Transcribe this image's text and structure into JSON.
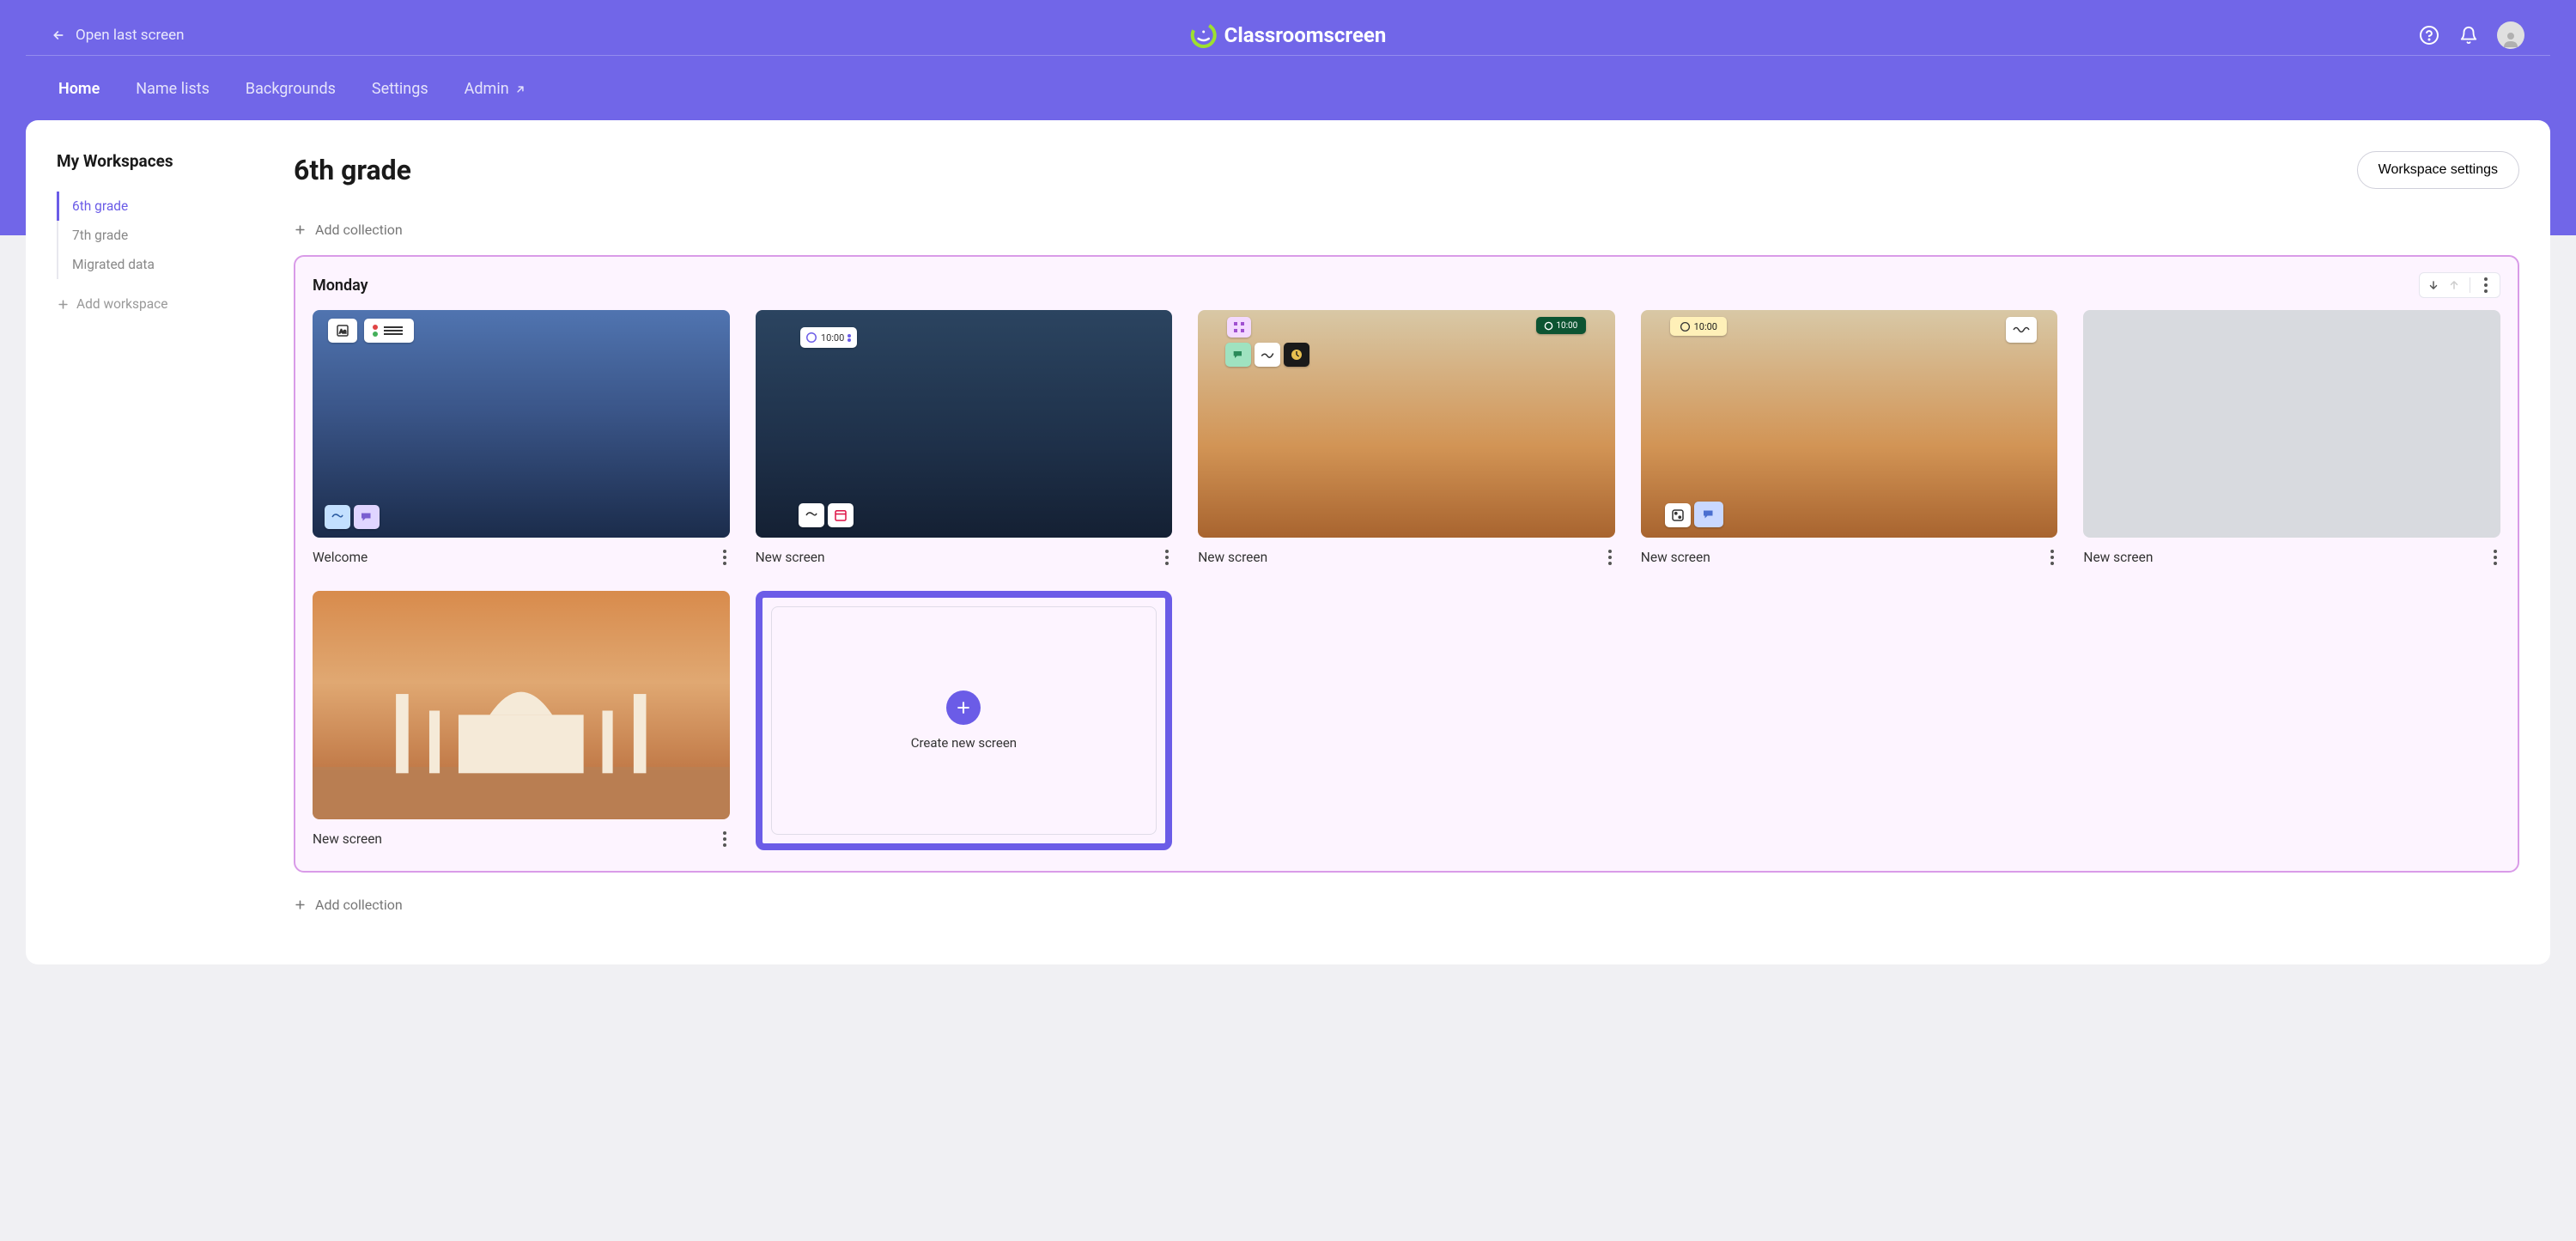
{
  "header": {
    "open_last": "Open last screen",
    "brand": "Classroomscreen"
  },
  "nav": {
    "home": "Home",
    "namelists": "Name lists",
    "backgrounds": "Backgrounds",
    "settings": "Settings",
    "admin": "Admin"
  },
  "sidebar": {
    "title": "My Workspaces",
    "items": [
      {
        "label": "6th grade",
        "active": true
      },
      {
        "label": "7th grade",
        "active": false
      },
      {
        "label": "Migrated data",
        "active": false
      }
    ],
    "add_label": "Add workspace"
  },
  "content": {
    "title": "6th grade",
    "workspace_settings_label": "Workspace settings",
    "add_collection_label": "Add collection"
  },
  "collection": {
    "name": "Monday",
    "screens": [
      {
        "name": "Welcome"
      },
      {
        "name": "New screen"
      },
      {
        "name": "New screen"
      },
      {
        "name": "New screen"
      },
      {
        "name": "New screen"
      },
      {
        "name": "New screen"
      }
    ],
    "create_label": "Create new screen"
  },
  "timer_badge": "10:00"
}
